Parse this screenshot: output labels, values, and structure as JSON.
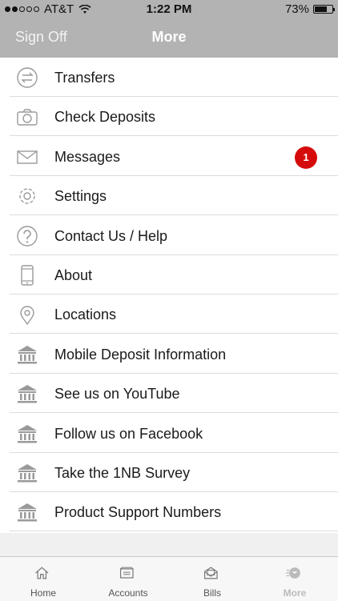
{
  "status": {
    "carrier": "AT&T",
    "time": "1:22 PM",
    "battery": "73%",
    "battery_level": 0.73
  },
  "nav": {
    "left": "Sign Off",
    "title": "More"
  },
  "menu": [
    {
      "label": "Transfers",
      "icon": "transfer-arrows-icon"
    },
    {
      "label": "Check Deposits",
      "icon": "camera-icon"
    },
    {
      "label": "Messages",
      "icon": "envelope-icon",
      "badge": "1"
    },
    {
      "label": "Settings",
      "icon": "gear-icon"
    },
    {
      "label": "Contact Us / Help",
      "icon": "question-icon"
    },
    {
      "label": "About",
      "icon": "phone-icon"
    },
    {
      "label": "Locations",
      "icon": "location-pin-icon"
    },
    {
      "label": "Mobile Deposit Information",
      "icon": "bank-icon"
    },
    {
      "label": "See us on YouTube",
      "icon": "bank-icon"
    },
    {
      "label": "Follow us on Facebook",
      "icon": "bank-icon"
    },
    {
      "label": "Take the 1NB Survey",
      "icon": "bank-icon"
    },
    {
      "label": "Product Support Numbers",
      "icon": "bank-icon"
    }
  ],
  "tabs": [
    {
      "label": "Home",
      "icon": "home-icon"
    },
    {
      "label": "Accounts",
      "icon": "accounts-icon"
    },
    {
      "label": "Bills",
      "icon": "bills-icon"
    },
    {
      "label": "More",
      "icon": "more-icon",
      "active": true
    }
  ],
  "colors": {
    "header": "#b3b3b3",
    "badge": "#d60b0b",
    "icon": "#9a9a9a"
  }
}
